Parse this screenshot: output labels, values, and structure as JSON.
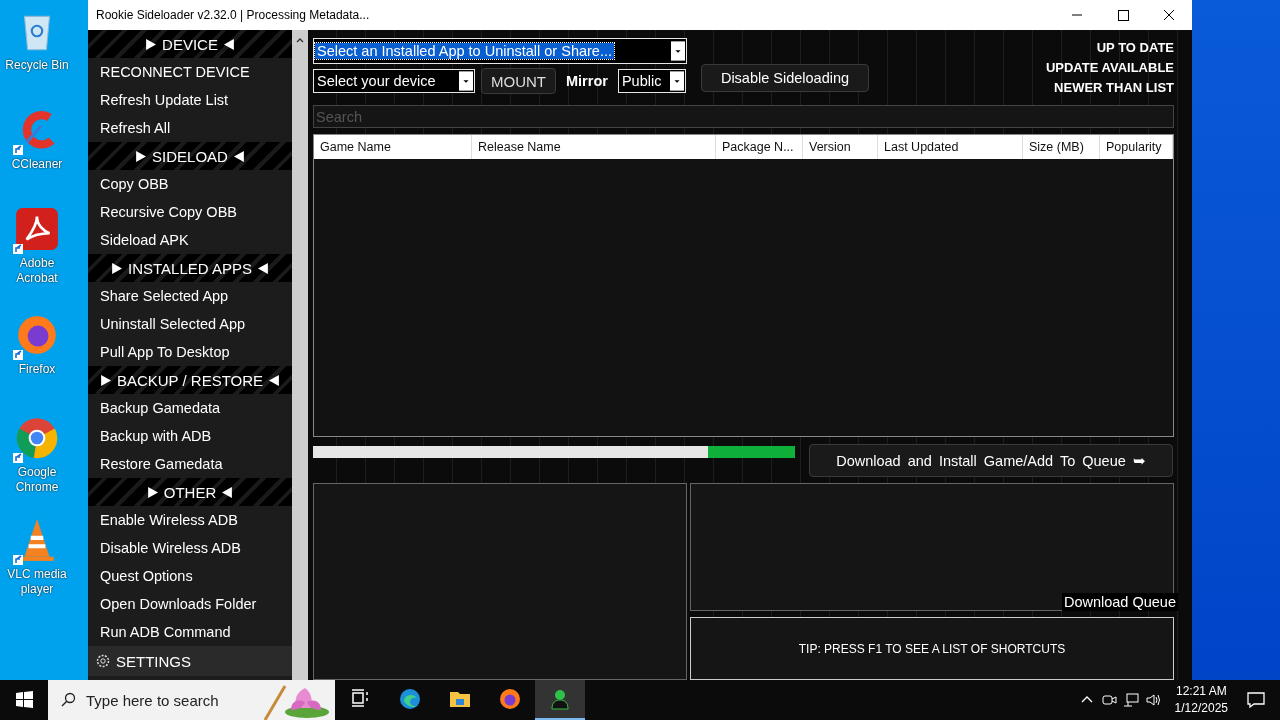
{
  "desktop_icons": [
    {
      "label": "Recycle Bin",
      "kind": "bin",
      "shortcut": false
    },
    {
      "label": "CCleaner",
      "kind": "ccleaner",
      "shortcut": true
    },
    {
      "label": "Adobe Acrobat",
      "kind": "acrobat",
      "shortcut": true
    },
    {
      "label": "Firefox",
      "kind": "firefox",
      "shortcut": true
    },
    {
      "label": "Google Chrome",
      "kind": "chrome",
      "shortcut": true
    },
    {
      "label": "VLC media player",
      "kind": "vlc",
      "shortcut": true
    }
  ],
  "window": {
    "title": "Rookie Sideloader v2.32.0 | Processing Metadata..."
  },
  "sidebar": {
    "sections": [
      {
        "header": "DEVICE",
        "items": [
          "RECONNECT DEVICE",
          "Refresh Update List",
          "Refresh All"
        ]
      },
      {
        "header": "SIDELOAD",
        "items": [
          "Copy OBB",
          "Recursive Copy OBB",
          "Sideload APK"
        ]
      },
      {
        "header": "INSTALLED APPS",
        "items": [
          "Share Selected App",
          "Uninstall Selected App",
          "Pull App To Desktop"
        ]
      },
      {
        "header": "BACKUP / RESTORE",
        "items": [
          "Backup Gamedata",
          "Backup with ADB",
          "Restore Gamedata"
        ]
      },
      {
        "header": "OTHER",
        "items": [
          "Enable Wireless ADB",
          "Disable Wireless ADB",
          "Quest Options",
          "Open Downloads Folder",
          "Run ADB Command"
        ]
      }
    ],
    "settings": "SETTINGS"
  },
  "installed_app_select": {
    "value": "Select an Installed App to Uninstall or Share...",
    "highlighted": true
  },
  "device_select": {
    "value": "Select your device"
  },
  "mount_button": "MOUNT",
  "mirror_label": "Mirror",
  "mirror_select": {
    "value": "Public"
  },
  "disable_sideloading_button": "Disable Sideloading",
  "legend": [
    "UP TO DATE",
    "UPDATE AVAILABLE",
    "NEWER THAN LIST"
  ],
  "search": {
    "placeholder": "Search"
  },
  "table": {
    "columns": [
      "Game Name",
      "Release Name",
      "Package N...",
      "Version",
      "Last Updated",
      "Size (MB)",
      "Popularity"
    ]
  },
  "progress": {
    "level": 0.18
  },
  "download_button": "Download and Install Game/Add To Queue ➥",
  "download_queue_label": "Download Queue",
  "tip": "TIP: PRESS F1 TO SEE A LIST OF SHORTCUTS",
  "taskbar": {
    "search_placeholder": "Type here to search",
    "apps": [
      {
        "kind": "taskview",
        "active": false
      },
      {
        "kind": "edge",
        "active": false
      },
      {
        "kind": "explorer",
        "active": false
      },
      {
        "kind": "firefox",
        "active": false
      },
      {
        "kind": "rookie",
        "active": true
      }
    ],
    "time": "12:21 AM",
    "date": "1/12/2025"
  }
}
